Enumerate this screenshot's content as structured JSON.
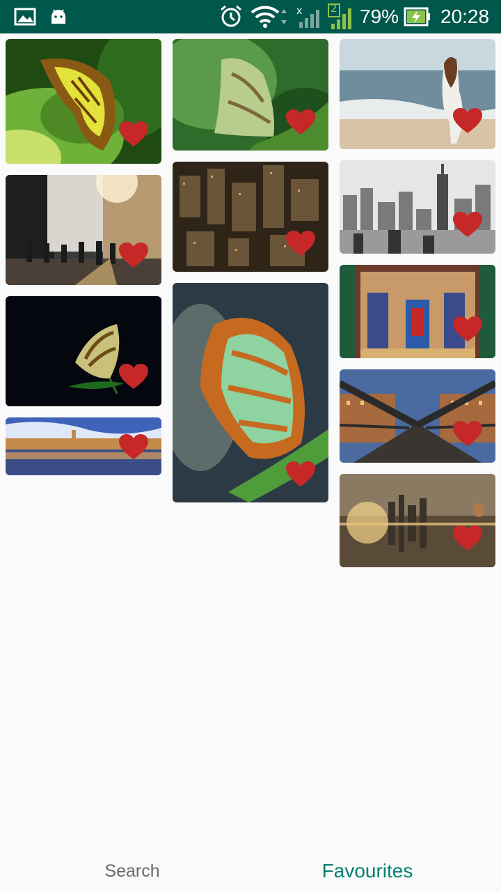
{
  "status_bar": {
    "battery_percent": "79%",
    "time": "20:28",
    "sim_label": "2",
    "icons": [
      "gallery-icon",
      "android-icon",
      "alarm-icon",
      "wifi-icon",
      "signal-icon",
      "battery-charging-icon"
    ]
  },
  "gallery": {
    "items": [
      {
        "subject": "butterfly-on-leaf",
        "favourite": true
      },
      {
        "subject": "butterfly-green",
        "favourite": true
      },
      {
        "subject": "woman-on-beach",
        "favourite": true
      },
      {
        "subject": "city-street-sunset",
        "favourite": true
      },
      {
        "subject": "city-aerial-night",
        "favourite": true
      },
      {
        "subject": "skyline-black-white",
        "favourite": true
      },
      {
        "subject": "butterfly-dark",
        "favourite": true
      },
      {
        "subject": "butterfly-closeup",
        "favourite": true
      },
      {
        "subject": "church-altar",
        "favourite": true
      },
      {
        "subject": "city-waterfront-panorama",
        "favourite": true
      },
      {
        "subject": "bridge-warehouses",
        "favourite": true
      },
      {
        "subject": "surreal-city-reflection",
        "favourite": true
      }
    ]
  },
  "bottom_nav": {
    "search_label": "Search",
    "favourites_label": "Favourites",
    "active_tab": "Favourites"
  },
  "colors": {
    "status_bar": "#00574b",
    "accent": "#00806e",
    "heart": "#c62828",
    "inactive_tab": "#6b6b6b"
  }
}
